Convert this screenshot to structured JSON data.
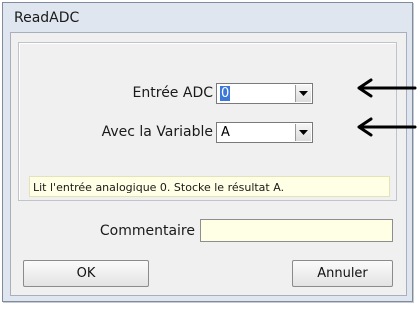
{
  "dialog": {
    "title": "ReadADC",
    "adc_input_label": "Entrée ADC",
    "adc_input_value": "0",
    "variable_label": "Avec la Variable",
    "variable_value": "A",
    "description": "Lit l'entrée analogique 0. Stocke le résultat A.",
    "comment_label": "Commentaire",
    "comment_value": "",
    "ok_label": "OK",
    "cancel_label": "Annuler"
  },
  "colors": {
    "hint_background": "#ffffe6",
    "selection": "#3b78d8",
    "arrow": "#000000"
  },
  "icons": {
    "dropdown": "chevron-down-icon",
    "pointer": "arrow-left-icon"
  }
}
